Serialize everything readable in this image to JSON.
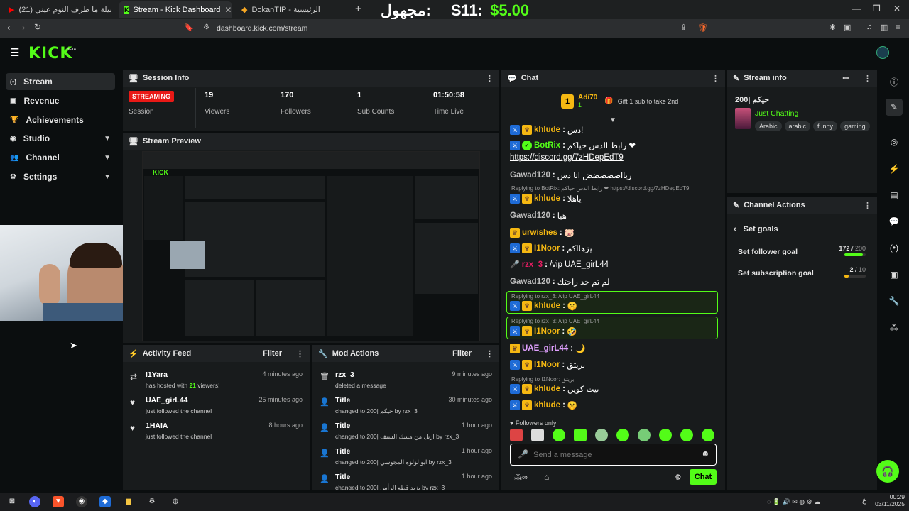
{
  "browser": {
    "tabs": [
      {
        "label": "(21) شيلة ما طرف النوم عيني - YouTube",
        "active": false
      },
      {
        "label": "Stream - Kick Dashboard",
        "active": true
      },
      {
        "label": "DokanTIP - الرئيسية",
        "active": false
      }
    ],
    "overlay": {
      "left_text": "مجهول:",
      "right_text": "S11:",
      "amount": "$5.00"
    },
    "url": "dashboard.kick.com/stream"
  },
  "header": {
    "logo": "KICK",
    "beta": "BETA"
  },
  "sidebar": {
    "items": [
      {
        "label": "Stream",
        "icon": "stream-icon",
        "active": true,
        "chevron": false
      },
      {
        "label": "Revenue",
        "icon": "revenue-icon",
        "active": false,
        "chevron": false
      },
      {
        "label": "Achievements",
        "icon": "trophy-icon",
        "active": false,
        "chevron": false
      },
      {
        "label": "Studio",
        "icon": "studio-icon",
        "active": false,
        "chevron": true
      },
      {
        "label": "Channel",
        "icon": "channel-icon",
        "active": false,
        "chevron": true
      },
      {
        "label": "Settings",
        "icon": "gear-icon",
        "active": false,
        "chevron": true
      }
    ]
  },
  "session": {
    "title": "Session Info",
    "status": "STREAMING",
    "status_label": "Session",
    "viewers": "19",
    "viewers_label": "Viewers",
    "followers": "170",
    "followers_label": "Followers",
    "subs": "1",
    "subs_label": "Sub Counts",
    "time": "01:50:58",
    "time_label": "Time Live"
  },
  "preview": {
    "title": "Stream Preview"
  },
  "activity": {
    "title": "Activity Feed",
    "filter": "Filter",
    "items": [
      {
        "user": "I1Yara",
        "desc_a": "has hosted with ",
        "count": "21",
        "desc_b": " viewers!",
        "ago": "4 minutes ago",
        "icon": "host-icon"
      },
      {
        "user": "UAE_girL44",
        "desc": "just followed the channel",
        "ago": "25 minutes ago",
        "icon": "heart-icon"
      },
      {
        "user": "1HAIA",
        "desc": "just followed the channel",
        "ago": "8 hours ago",
        "icon": "heart-icon"
      }
    ]
  },
  "mod": {
    "title": "Mod Actions",
    "filter": "Filter",
    "items": [
      {
        "title": "rzx_3",
        "desc": "deleted a message",
        "ago": "9 minutes ago",
        "icon": "trash-icon"
      },
      {
        "title": "Title",
        "desc": "changed to 200| حيكم by rzx_3",
        "ago": "30 minutes ago",
        "icon": "user-edit-icon"
      },
      {
        "title": "Title",
        "desc": "changed to 200| ازيل من مسك السيف by rzx_3",
        "ago": "1 hour ago",
        "icon": "user-edit-icon"
      },
      {
        "title": "Title",
        "desc": "changed to 200| ابو لؤلؤه المجوسي by rzx_3",
        "ago": "1 hour ago",
        "icon": "user-edit-icon"
      },
      {
        "title": "Title",
        "desc": "changed to 200| يزيد قطع الرأس by rzx_3",
        "ago": "1 hour ago",
        "icon": "user-edit-icon"
      }
    ]
  },
  "chat": {
    "title": "Chat",
    "gift_user": "Adi70",
    "gift_rank": "1",
    "gift_count": "1",
    "gift_text": "Gift 1 sub to take 2nd",
    "messages": [
      {
        "user": "khlude",
        "text": "دس!",
        "color": "#f5b812",
        "badges": [
          "mod",
          "crown"
        ]
      },
      {
        "user": "BotRix",
        "text": "رابط الدس حياكم ❤",
        "color": "#53fc18",
        "badges": [
          "mod",
          "verify"
        ]
      },
      {
        "user": "",
        "text": "https://discord.gg/7zHDepEdT9",
        "color": "#ffffff",
        "badges": [],
        "link": true
      },
      {
        "user": "Gawad120",
        "text": "ريااضضضضض انا دس",
        "color": "#bdbdbd",
        "badges": []
      },
      {
        "reply": "Replying to BotRix: رابط الدس حياكم ❤ https://discord.gg/7zHDepEdT9"
      },
      {
        "user": "khlude",
        "text": "ياهلا",
        "color": "#f5b812",
        "badges": [
          "mod",
          "crown"
        ]
      },
      {
        "user": "Gawad120",
        "text": "هيا",
        "color": "#bdbdbd",
        "badges": []
      },
      {
        "user": "urwishes",
        "text": "🐷",
        "color": "#f5b812",
        "badges": [
          "crown"
        ]
      },
      {
        "user": "I1Noor",
        "text": "يزهااكم",
        "color": "#f5b812",
        "badges": [
          "mod",
          "crown"
        ]
      },
      {
        "user": "rzx_3",
        "text": "/vip UAE_girL44",
        "color": "#e91e63",
        "badges": [
          "mic"
        ]
      },
      {
        "user": "Gawad120",
        "text": "لم تم خذ راحتك",
        "color": "#bdbdbd",
        "badges": []
      },
      {
        "reply": "Replying to rzx_3: /vip UAE_girL44",
        "highlight": true
      },
      {
        "user": "khlude",
        "text": "🤫",
        "color": "#f5b812",
        "badges": [
          "mod",
          "crown"
        ],
        "highlight": true
      },
      {
        "reply": "Replying to rzx_3: /vip UAE_girL44",
        "highlight": true
      },
      {
        "user": "I1Noor",
        "text": "🤣",
        "color": "#f5b812",
        "badges": [
          "mod",
          "crown"
        ],
        "highlight": true
      },
      {
        "user": "UAE_girL44",
        "text": "🌙",
        "color": "#e0a0ff",
        "badges": [
          "crown"
        ]
      },
      {
        "user": "I1Noor",
        "text": "بريتق",
        "color": "#f5b812",
        "badges": [
          "mod",
          "crown"
        ]
      },
      {
        "reply": "Replying to I1Noor: بريتق"
      },
      {
        "user": "khlude",
        "text": "تيت كوين",
        "color": "#f5b812",
        "badges": [
          "mod",
          "crown"
        ]
      },
      {
        "user": "khlude",
        "text": "🤫",
        "color": "#f5b812",
        "badges": [
          "mod",
          "crown"
        ]
      }
    ],
    "followers_only": "Followers only",
    "placeholder": "Send a message",
    "send": "Chat"
  },
  "stream_info": {
    "title": "Stream info",
    "stream_title": "200| حيكم",
    "category": "Just Chatting",
    "tags": [
      "Arabic",
      "arabic",
      "funny",
      "gaming"
    ]
  },
  "channel_actions": {
    "title": "Channel Actions",
    "back_label": "Set goals",
    "follower_goal": {
      "label": "Set follower goal",
      "current": "172",
      "target": "200",
      "progress": 0.86
    },
    "sub_goal": {
      "label": "Set subscription goal",
      "current": "2",
      "target": "10",
      "progress": 0.2
    }
  },
  "taskbar": {
    "time": "00:29",
    "date": "03/11/2025",
    "lang": "ع"
  },
  "colors": {
    "accent": "#53fc18",
    "live": "#e91916",
    "panel": "#181b1c"
  }
}
